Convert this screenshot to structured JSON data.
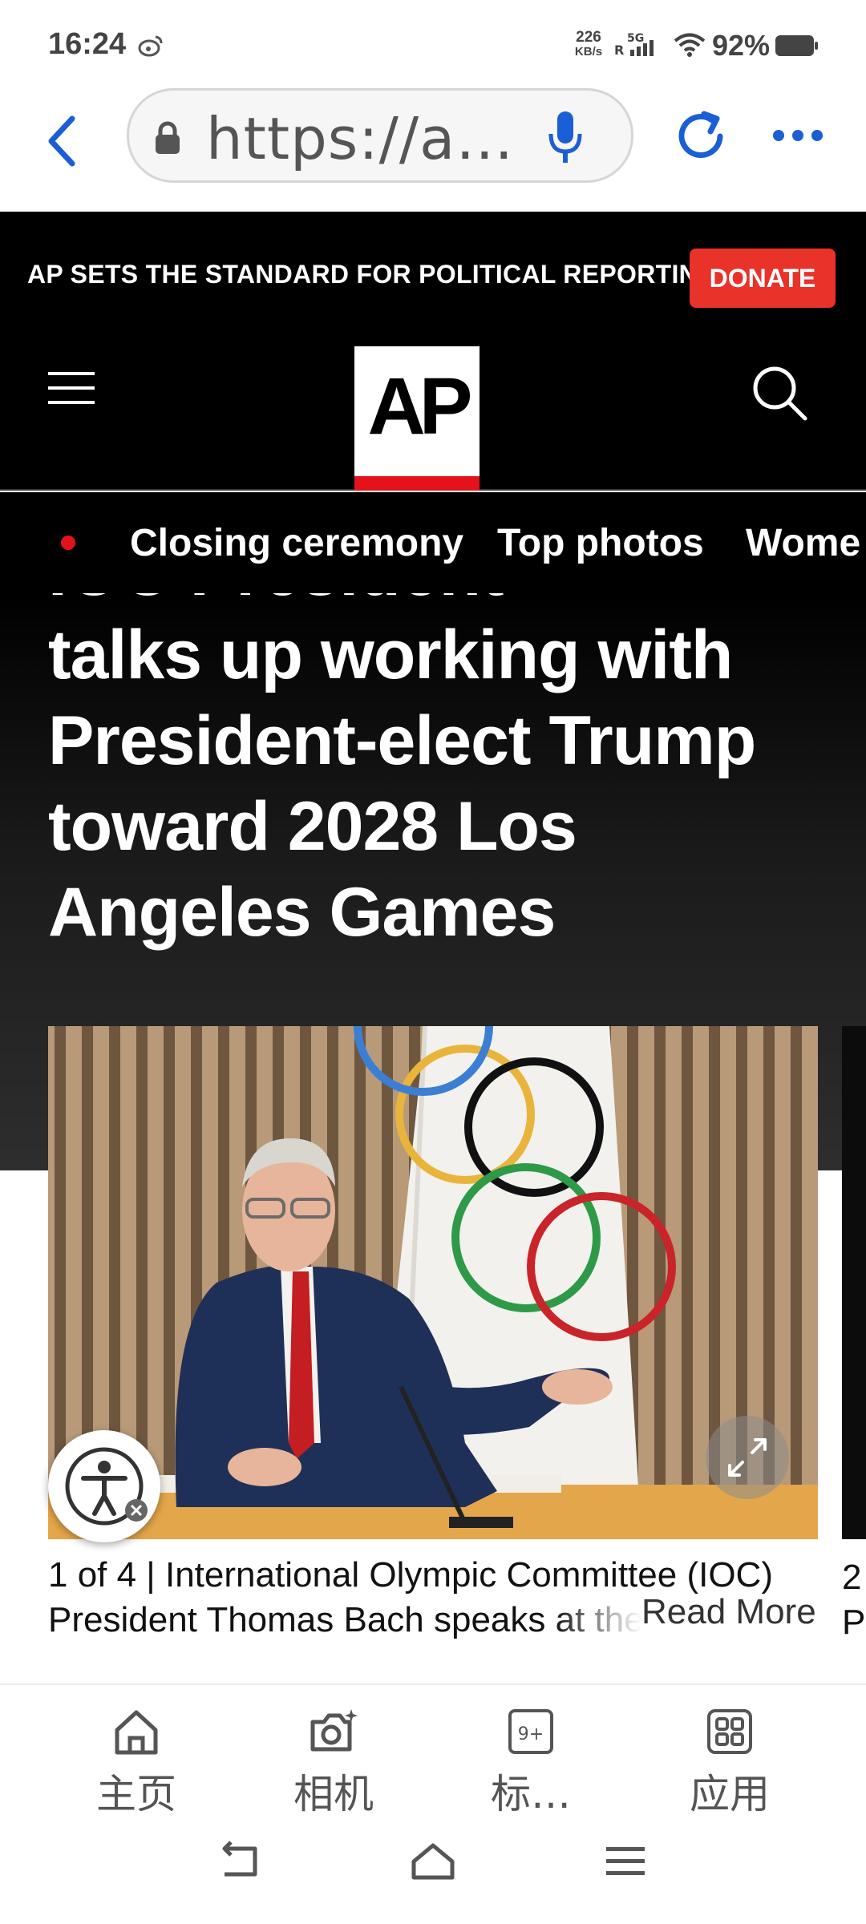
{
  "status": {
    "time": "16:24",
    "net_speed": "226",
    "net_unit": "KB/s",
    "battery": "92%",
    "icons": [
      "weibo-icon",
      "cell-signal-icon",
      "wifi-icon",
      "battery-icon"
    ]
  },
  "browser": {
    "url": "https://a…",
    "icons": [
      "back-icon",
      "lock-icon",
      "mic-icon",
      "reload-icon",
      "more-icon"
    ],
    "accent": "#1a5fd6"
  },
  "site": {
    "banner_text": "AP SETS THE STANDARD FOR POLITICAL REPORTING.",
    "donate_label": "DONATE",
    "logo_text": "AP",
    "nav_topics": [
      "Closing ceremony",
      "Top photos",
      "Wome"
    ],
    "headline_cut": "IOC President",
    "headline": "talks up working with President-elect Trump toward 2028 Los Angeles Games",
    "gallery": {
      "counter": "1 of 4 |",
      "caption_line1": "International Olympic Committee (IOC)",
      "caption_line2": "President Thomas Bach speaks at the c",
      "read_more": "Read More",
      "next_counter": "2",
      "next_caption": "Pr"
    },
    "colors": {
      "donate": "#e8322a",
      "brand_red": "#e4121b",
      "background": "#000000"
    }
  },
  "toolbar": {
    "items": [
      {
        "label": "主页",
        "icon": "home-icon"
      },
      {
        "label": "相机",
        "icon": "camera-icon"
      },
      {
        "label": "标…",
        "icon": "tabs-icon",
        "badge": "9+"
      },
      {
        "label": "应用",
        "icon": "apps-icon"
      }
    ]
  },
  "system_nav": {
    "icons": [
      "back-nav-icon",
      "home-nav-icon",
      "recents-nav-icon"
    ]
  }
}
